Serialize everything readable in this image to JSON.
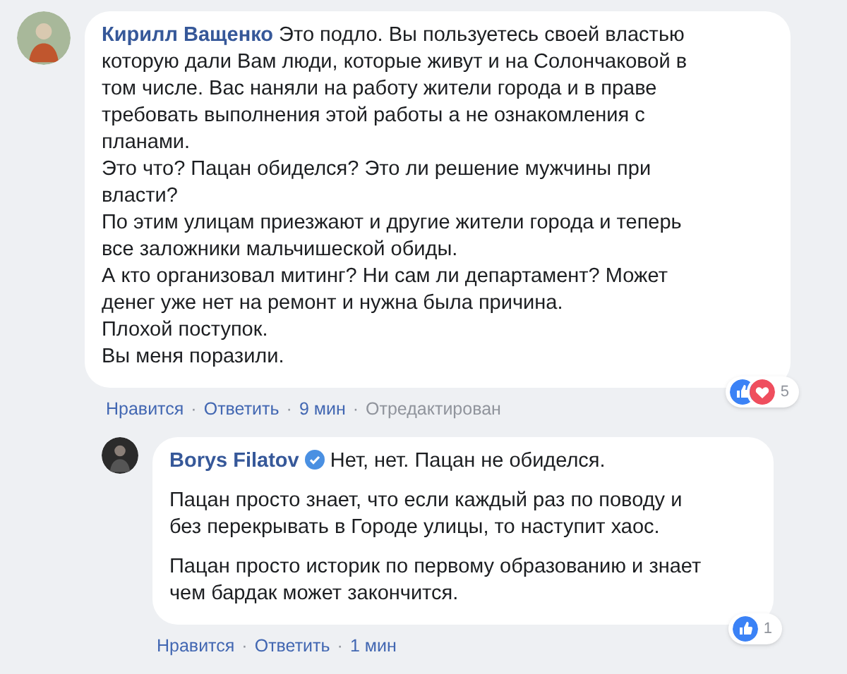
{
  "comments": [
    {
      "author": "Кирилл Ващенко",
      "body": [
        [
          "Это подло. Вы пользуетесь своей властью",
          "которую дали Вам люди, которые живут и на Солончаковой в",
          "том числе. Вас наняли на работу жители города и в праве",
          "требовать выполнения этой работы а не ознакомления с",
          "планами."
        ],
        [
          "Это что? Пацан обиделся? Это ли решение мужчины при",
          "власти?"
        ],
        [
          "По этим улицам приезжают и другие жители города и теперь",
          "все заложники мальчишеской обиды."
        ],
        [
          "А кто организовал митинг? Ни сам ли департамент? Может",
          "денег уже нет на ремонт и нужна была причина."
        ],
        [
          "Плохой поступок."
        ],
        [
          "Вы меня поразили."
        ]
      ],
      "spaced": false,
      "reactions": [
        {
          "kind": "like"
        },
        {
          "kind": "love"
        }
      ],
      "reaction_count": "5",
      "actions": [
        "Нравится",
        "·",
        "Ответить",
        "·"
      ],
      "time": "9 мин",
      "edited_separator": "·",
      "edited": "Отредактирован",
      "replies": [
        {
          "author": "Borys Filatov",
          "verified": true,
          "body": [
            [
              "Нет, нет. Пацан не обиделся."
            ],
            [
              "Пацан просто знает, что если каждый раз по поводу и",
              "без перекрывать в Городе улицы, то наступит хаос."
            ],
            [
              "Пацан просто историк по первому образованию и знает",
              "чем бардак может закончится."
            ]
          ],
          "spaced": true,
          "reactions": [
            {
              "kind": "like"
            }
          ],
          "reaction_count": "1",
          "actions": [
            "Нравится",
            "·",
            "Ответить",
            "·"
          ],
          "time": "1 мин"
        }
      ]
    }
  ]
}
